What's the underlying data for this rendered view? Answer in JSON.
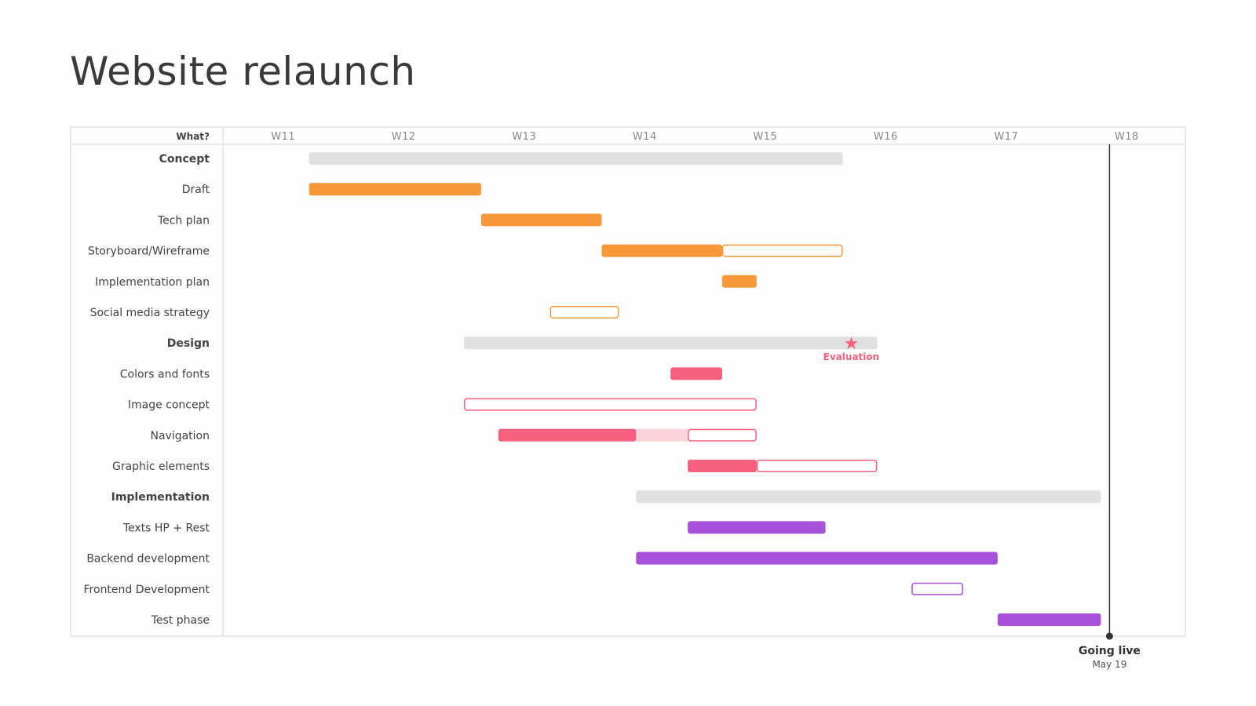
{
  "title": "Website relaunch",
  "colors": {
    "concept": "#f7993a",
    "design": "#f5607e",
    "design_light": "#fbd3db",
    "implementation": "#a851da",
    "summary": "#e0e0e0",
    "milestone_line": "#333333"
  },
  "chart_data": {
    "type": "gantt",
    "title": "Website relaunch",
    "label_header": "What?",
    "time_unit": "days from start of W11",
    "weeks": [
      "W11",
      "W12",
      "W13",
      "W14",
      "W15",
      "W16",
      "W17",
      "W18"
    ],
    "tasks": [
      {
        "label": "Concept",
        "kind": "group",
        "group": "concept",
        "start": 5,
        "end": 36
      },
      {
        "label": "Draft",
        "kind": "task",
        "group": "concept",
        "start": 5,
        "end": 15,
        "done_until": 15
      },
      {
        "label": "Tech plan",
        "kind": "task",
        "group": "concept",
        "start": 15,
        "end": 22,
        "done_until": 22
      },
      {
        "label": "Storyboard/Wireframe",
        "kind": "task",
        "group": "concept",
        "start": 22,
        "end": 36,
        "done_until": 29
      },
      {
        "label": "Implementation plan",
        "kind": "task",
        "group": "concept",
        "start": 29,
        "end": 31,
        "done_until": 31
      },
      {
        "label": "Social media strategy",
        "kind": "task",
        "group": "concept",
        "start": 19,
        "end": 23,
        "done_until": 19
      },
      {
        "label": "Design",
        "kind": "group",
        "group": "design",
        "start": 14,
        "end": 38
      },
      {
        "label": "Colors and fonts",
        "kind": "task",
        "group": "design",
        "start": 26,
        "end": 29,
        "done_until": 29
      },
      {
        "label": "Image concept",
        "kind": "task",
        "group": "design",
        "start": 14,
        "end": 31,
        "done_until": 14
      },
      {
        "label": "Navigation",
        "kind": "task",
        "group": "design",
        "start": 16,
        "end": 31,
        "done_until": 24,
        "light_until": 27
      },
      {
        "label": "Graphic elements",
        "kind": "task",
        "group": "design",
        "start": 27,
        "end": 38,
        "done_until": 31
      },
      {
        "label": "Implementation",
        "kind": "group",
        "group": "implementation",
        "start": 24,
        "end": 51
      },
      {
        "label": "Texts HP + Rest",
        "kind": "task",
        "group": "implementation",
        "start": 27,
        "end": 35,
        "done_until": 35
      },
      {
        "label": "Backend development",
        "kind": "task",
        "group": "implementation",
        "start": 24,
        "end": 45,
        "done_until": 45
      },
      {
        "label": "Frontend Development",
        "kind": "task",
        "group": "implementation",
        "start": 40,
        "end": 43,
        "done_until": 40
      },
      {
        "label": "Test phase",
        "kind": "task",
        "group": "implementation",
        "start": 45,
        "end": 51,
        "done_until": 51
      }
    ],
    "milestones": [
      {
        "label": "Evaluation",
        "row": 6,
        "day": 36.5,
        "group": "design",
        "icon": "star"
      }
    ],
    "deadline": {
      "label": "Going live",
      "date": "May 19",
      "day": 51.5
    }
  }
}
